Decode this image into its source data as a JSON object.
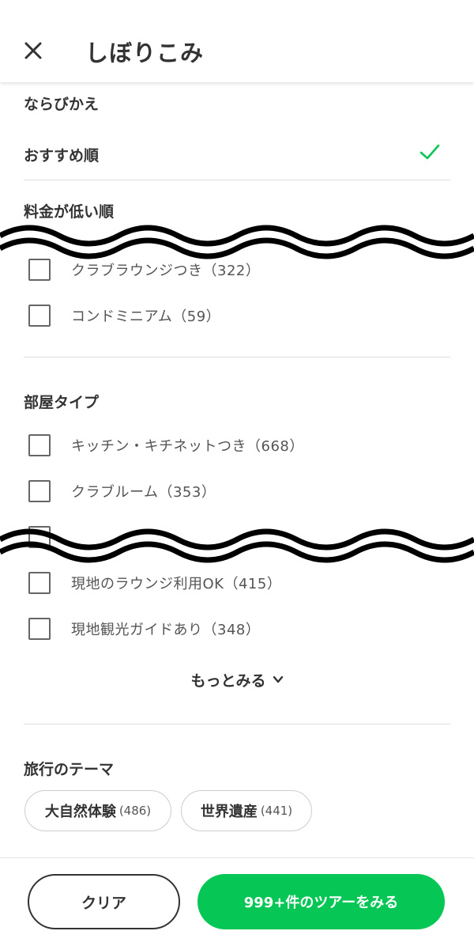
{
  "header": {
    "title": "しぼりこみ",
    "close_icon": "close-icon"
  },
  "sort": {
    "title": "ならびかえ",
    "options": [
      {
        "label": "おすすめ順",
        "selected": true
      },
      {
        "label": "料金が低い順",
        "selected": false
      }
    ],
    "check_color": "#06c755"
  },
  "features": {
    "items": [
      {
        "label": "クラブラウンジつき（322）",
        "checked": false
      },
      {
        "label": "コンドミニアム（59）",
        "checked": false
      }
    ]
  },
  "room_type": {
    "title": "部屋タイプ",
    "items": [
      {
        "label": "キッチン・キチネットつき（668）",
        "checked": false
      },
      {
        "label": "クラブルーム（353）",
        "checked": false
      },
      {
        "label": "現地のラウンジ利用OK（415）",
        "checked": false
      },
      {
        "label": "現地観光ガイドあり（348）",
        "checked": false
      }
    ],
    "more_label": "もっとみる"
  },
  "theme": {
    "title": "旅行のテーマ",
    "chips": [
      {
        "label": "大自然体験",
        "count": "(486)"
      },
      {
        "label": "世界遺産",
        "count": "(441)"
      }
    ]
  },
  "footer": {
    "clear_label": "クリア",
    "show_label": "999+件のツアーをみる",
    "accent": "#06c755"
  }
}
